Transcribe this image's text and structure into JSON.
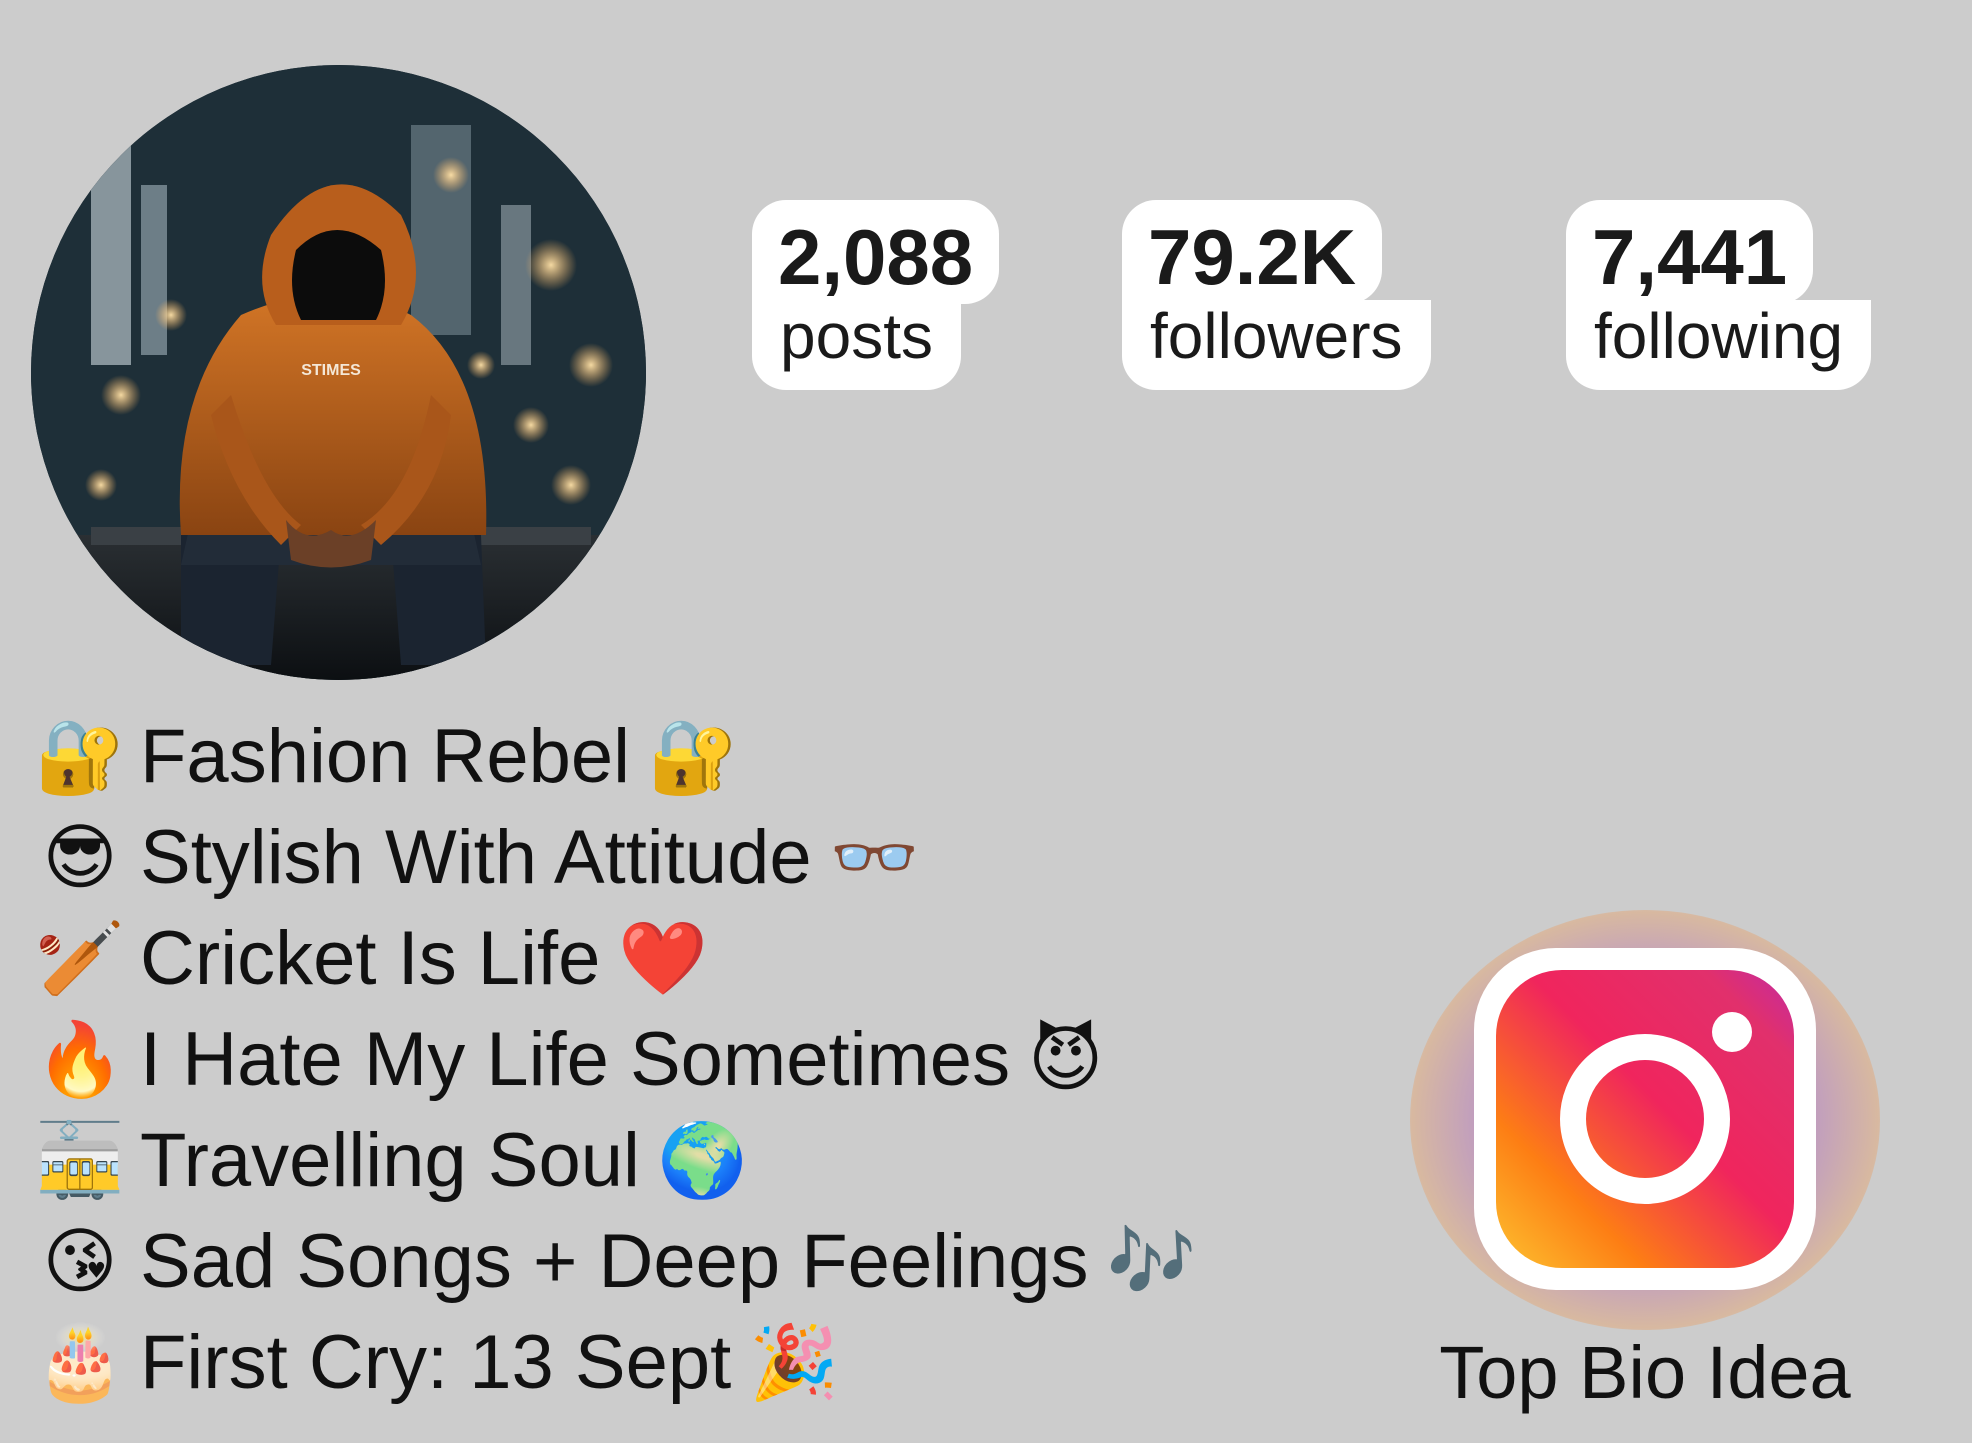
{
  "profile": {
    "avatar_description": "person-in-orange-hoodie",
    "avatar_hoodie_text": "STIMES",
    "stats": [
      {
        "value": "2,088",
        "label": "posts"
      },
      {
        "value": "79.2K",
        "label": "followers"
      },
      {
        "value": "7,441",
        "label": "following"
      }
    ]
  },
  "bio": {
    "lines": [
      {
        "lead_emoji": "🔐",
        "text": "Fashion Rebel",
        "trail_emoji": "🔐"
      },
      {
        "lead_emoji": "😎",
        "text": "Stylish With Attitude",
        "trail_emoji": "👓"
      },
      {
        "lead_emoji": "🏏",
        "text": "Cricket Is Life",
        "trail_emoji": "❤️"
      },
      {
        "lead_emoji": "🔥",
        "text": "I Hate My Life Sometimes",
        "trail_emoji": "😈"
      },
      {
        "lead_emoji": "🚋",
        "text": "Travelling Soul",
        "trail_emoji": "🌍"
      },
      {
        "lead_emoji": "😘",
        "text": "Sad Songs + Deep Feelings",
        "trail_emoji": "🎶"
      },
      {
        "lead_emoji": "🎂",
        "text": "First Cry: 13 Sept",
        "trail_emoji": "🎉"
      }
    ]
  },
  "branding": {
    "logo_icon": "instagram-icon",
    "caption": "Top Bio Idea"
  },
  "colors": {
    "background": "#cccccc",
    "hoodie": "#c2661c",
    "ig_pink": "#e1306c",
    "ig_orange": "#fd7e14"
  }
}
